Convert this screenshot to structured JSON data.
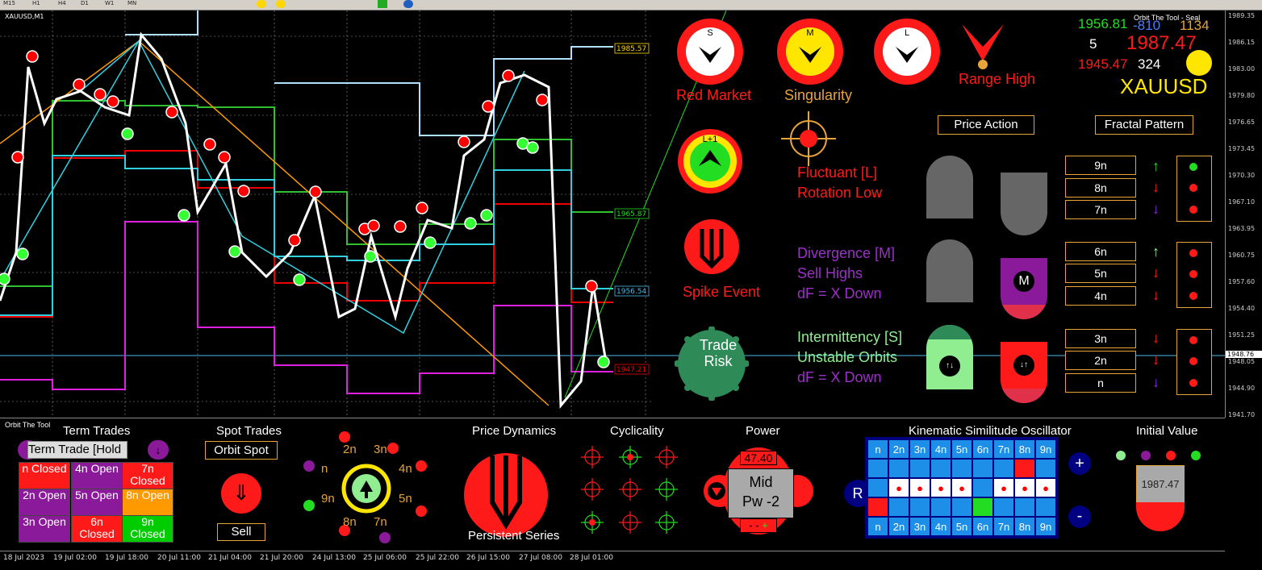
{
  "toolbar": {
    "items": [
      "M15",
      "H1",
      "H4",
      "D1",
      "W1",
      "MN"
    ]
  },
  "chart": {
    "symbol_label": "XAUUSD,M1",
    "price_ticks": [
      "1989.35",
      "1986.15",
      "1983.00",
      "1979.80",
      "1976.65",
      "1973.45",
      "1970.30",
      "1967.10",
      "1963.95",
      "1960.75",
      "1957.60",
      "1954.40",
      "1951.25",
      "1948.05",
      "1944.90",
      "1941.70"
    ],
    "current_price_tag": "1948.76",
    "level_labels": [
      "1985.57",
      "1965.87",
      "1956.54",
      "1947.21"
    ]
  },
  "time_axis": [
    "18 Jul 2023",
    "19 Jul 02:00",
    "19 Jul 18:00",
    "20 Jul 11:00",
    "21 Jul 04:00",
    "21 Jul 20:00",
    "24 Jul 13:00",
    "25 Jul 06:00",
    "25 Jul 22:00",
    "26 Jul 15:00",
    "27 Jul 08:00",
    "28 Jul 01:00"
  ],
  "hud": {
    "tool_name": "Orbit The Tool - Seal",
    "v1": "1956.81",
    "v2": "-810",
    "v3": "1134",
    "v4": "5",
    "price": "1987.47",
    "v5": "1945.47",
    "v6": "324",
    "symbol": "XAUUSD",
    "circles": [
      {
        "letter": "S",
        "label": "Red Market"
      },
      {
        "letter": "M",
        "label": "Singularity"
      },
      {
        "letter": "L",
        "label": ""
      },
      {
        "letter": "L+1",
        "label": ""
      }
    ],
    "range_high": "Range High",
    "spike_event": "Spike Event",
    "trade_risk": "Trade Risk",
    "price_action": "Price Action",
    "fractal_pattern": "Fractal Pattern",
    "groups": [
      {
        "lines": [
          "Fluctuant [L]",
          "Rotation Low"
        ],
        "color": "#ff2020"
      },
      {
        "lines": [
          "Divergence [M]",
          "Sell Highs",
          "dF = X Down"
        ],
        "color": "#9b30c8"
      },
      {
        "lines": [
          "Intermittency [S]",
          "Unstable Orbits",
          "dF = X Down"
        ],
        "color": "#90ee90"
      }
    ],
    "n_labels": [
      "9n",
      "8n",
      "7n",
      "6n",
      "5n",
      "4n",
      "3n",
      "2n",
      "n"
    ],
    "m_badge": "M",
    "colors": {
      "red": "#ff1a1a",
      "green": "#22dd22",
      "purple": "#8a2be2",
      "orange": "#e8a33a",
      "lime": "#90ee90"
    }
  },
  "panel": {
    "name": "Orbit The Tool",
    "term_trades": {
      "title": "Term Trades",
      "hold_btn": "Term Trade [Hold",
      "cells": [
        {
          "label": "n Closed",
          "bg": "#ff1a1a"
        },
        {
          "label": "4n Open",
          "bg": "#8a1a9a"
        },
        {
          "label": "7n Closed",
          "bg": "#ff1a1a"
        },
        {
          "label": "2n Open",
          "bg": "#8a1a9a"
        },
        {
          "label": "5n Open",
          "bg": "#8a1a9a"
        },
        {
          "label": "8n Open",
          "bg": "#ff9900"
        },
        {
          "label": "3n Open",
          "bg": "#8a1a9a"
        },
        {
          "label": "6n Closed",
          "bg": "#ff1a1a"
        },
        {
          "label": "9n Closed",
          "bg": "#00cc00"
        }
      ]
    },
    "spot_trades": {
      "title": "Spot Trades",
      "orbit_spot": "Orbit Spot",
      "sell": "Sell"
    },
    "orbit_labels": [
      "2n",
      "3n",
      "4n",
      "5n",
      "7n",
      "8n",
      "9n",
      "n"
    ],
    "price_dynamics": {
      "title": "Price Dynamics",
      "label": "Persistent Series"
    },
    "cyclicality": {
      "title": "Cyclicality"
    },
    "power": {
      "title": "Power",
      "value": "47.40",
      "mode": "Mid",
      "pw": "Pw -2"
    },
    "kso": {
      "title": "Kinematic Similitude Oscillator",
      "header": [
        "n",
        "2n",
        "3n",
        "4n",
        "5n",
        "6n",
        "7n",
        "8n",
        "9n"
      ],
      "r_label": "R",
      "plus": "+",
      "minus": "-"
    },
    "initial_value": {
      "title": "Initial Value",
      "value": "1987.47"
    }
  }
}
